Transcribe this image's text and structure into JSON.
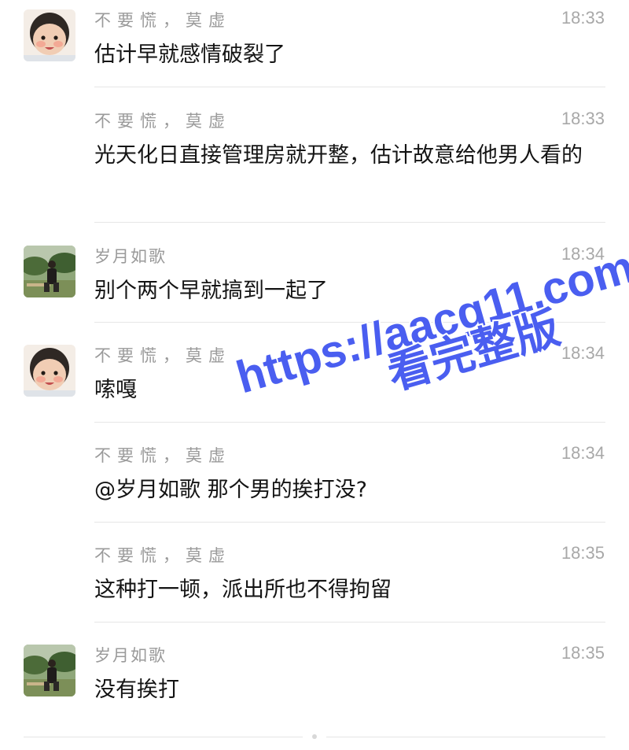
{
  "messages": [
    {
      "sender": "不要慌，莫虚",
      "time": "18:33",
      "text": "估计早就感情破裂了",
      "avatar": "baby-avatar"
    },
    {
      "sender": "不要慌，莫虚",
      "time": "18:33",
      "text": "光天化日直接管理房就开整，估计故意给他男人看的",
      "avatar": ""
    },
    {
      "sender": "岁月如歌",
      "time": "18:34",
      "text": "别个两个早就搞到一起了",
      "avatar": "man-avatar"
    },
    {
      "sender": "不要慌，莫虚",
      "time": "18:34",
      "text": "嗦嘎",
      "avatar": "baby-avatar"
    },
    {
      "sender": "不要慌，莫虚",
      "time": "18:34",
      "text": "@岁月如歌 那个男的挨打没?",
      "avatar": ""
    },
    {
      "sender": "不要慌，莫虚",
      "time": "18:35",
      "text": "这种打一顿，派出所也不得拘留",
      "avatar": ""
    },
    {
      "sender": "岁月如歌",
      "time": "18:35",
      "text": "没有挨打",
      "avatar": "man-avatar"
    }
  ],
  "watermark": {
    "line1": "https://aacg11.com",
    "line2": "看完整版",
    "color": "#4a5ef0"
  }
}
